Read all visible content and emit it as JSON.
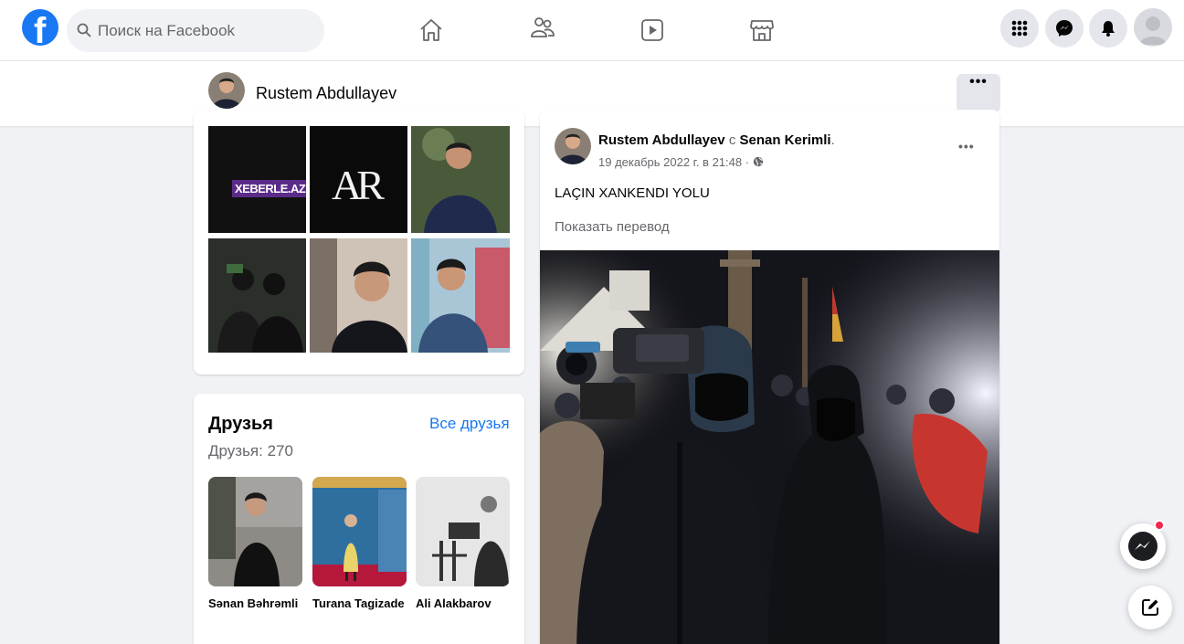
{
  "header": {
    "search_placeholder": "Поиск на Facebook",
    "logo_letter": "f",
    "nav": [
      "home-icon",
      "friends-icon",
      "watch-icon",
      "marketplace-icon"
    ],
    "actions": [
      "menu-grid-icon",
      "messenger-icon",
      "bell-icon",
      "account-avatar"
    ]
  },
  "profile": {
    "name": "Rustem Abdullayev",
    "more_label": "•••"
  },
  "photos": {
    "tiles": [
      {
        "label": "XEBERLE.AZ"
      },
      {
        "label": "AR"
      },
      {
        "label": ""
      },
      {
        "label": ""
      },
      {
        "label": ""
      },
      {
        "label": ""
      }
    ]
  },
  "friends": {
    "title": "Друзья",
    "see_all": "Все друзья",
    "count": "Друзья: 270",
    "items": [
      {
        "name": "Sənan Bəhrəmli"
      },
      {
        "name": "Turana Tagizade"
      },
      {
        "name": "Ali Alakbarov"
      }
    ]
  },
  "post": {
    "author": "Rustem Abdullayev",
    "with_word": "с",
    "tagged": "Senan Kerimli",
    "date": "19 декабрь 2022 г. в 21:48 · ",
    "text": "LAÇIN XANKENDI YOLU",
    "translate": "Показать перевод",
    "more_label": "•••"
  },
  "colors": {
    "accent": "#1877f2",
    "background": "#f0f2f5",
    "notification": "#f02849"
  }
}
